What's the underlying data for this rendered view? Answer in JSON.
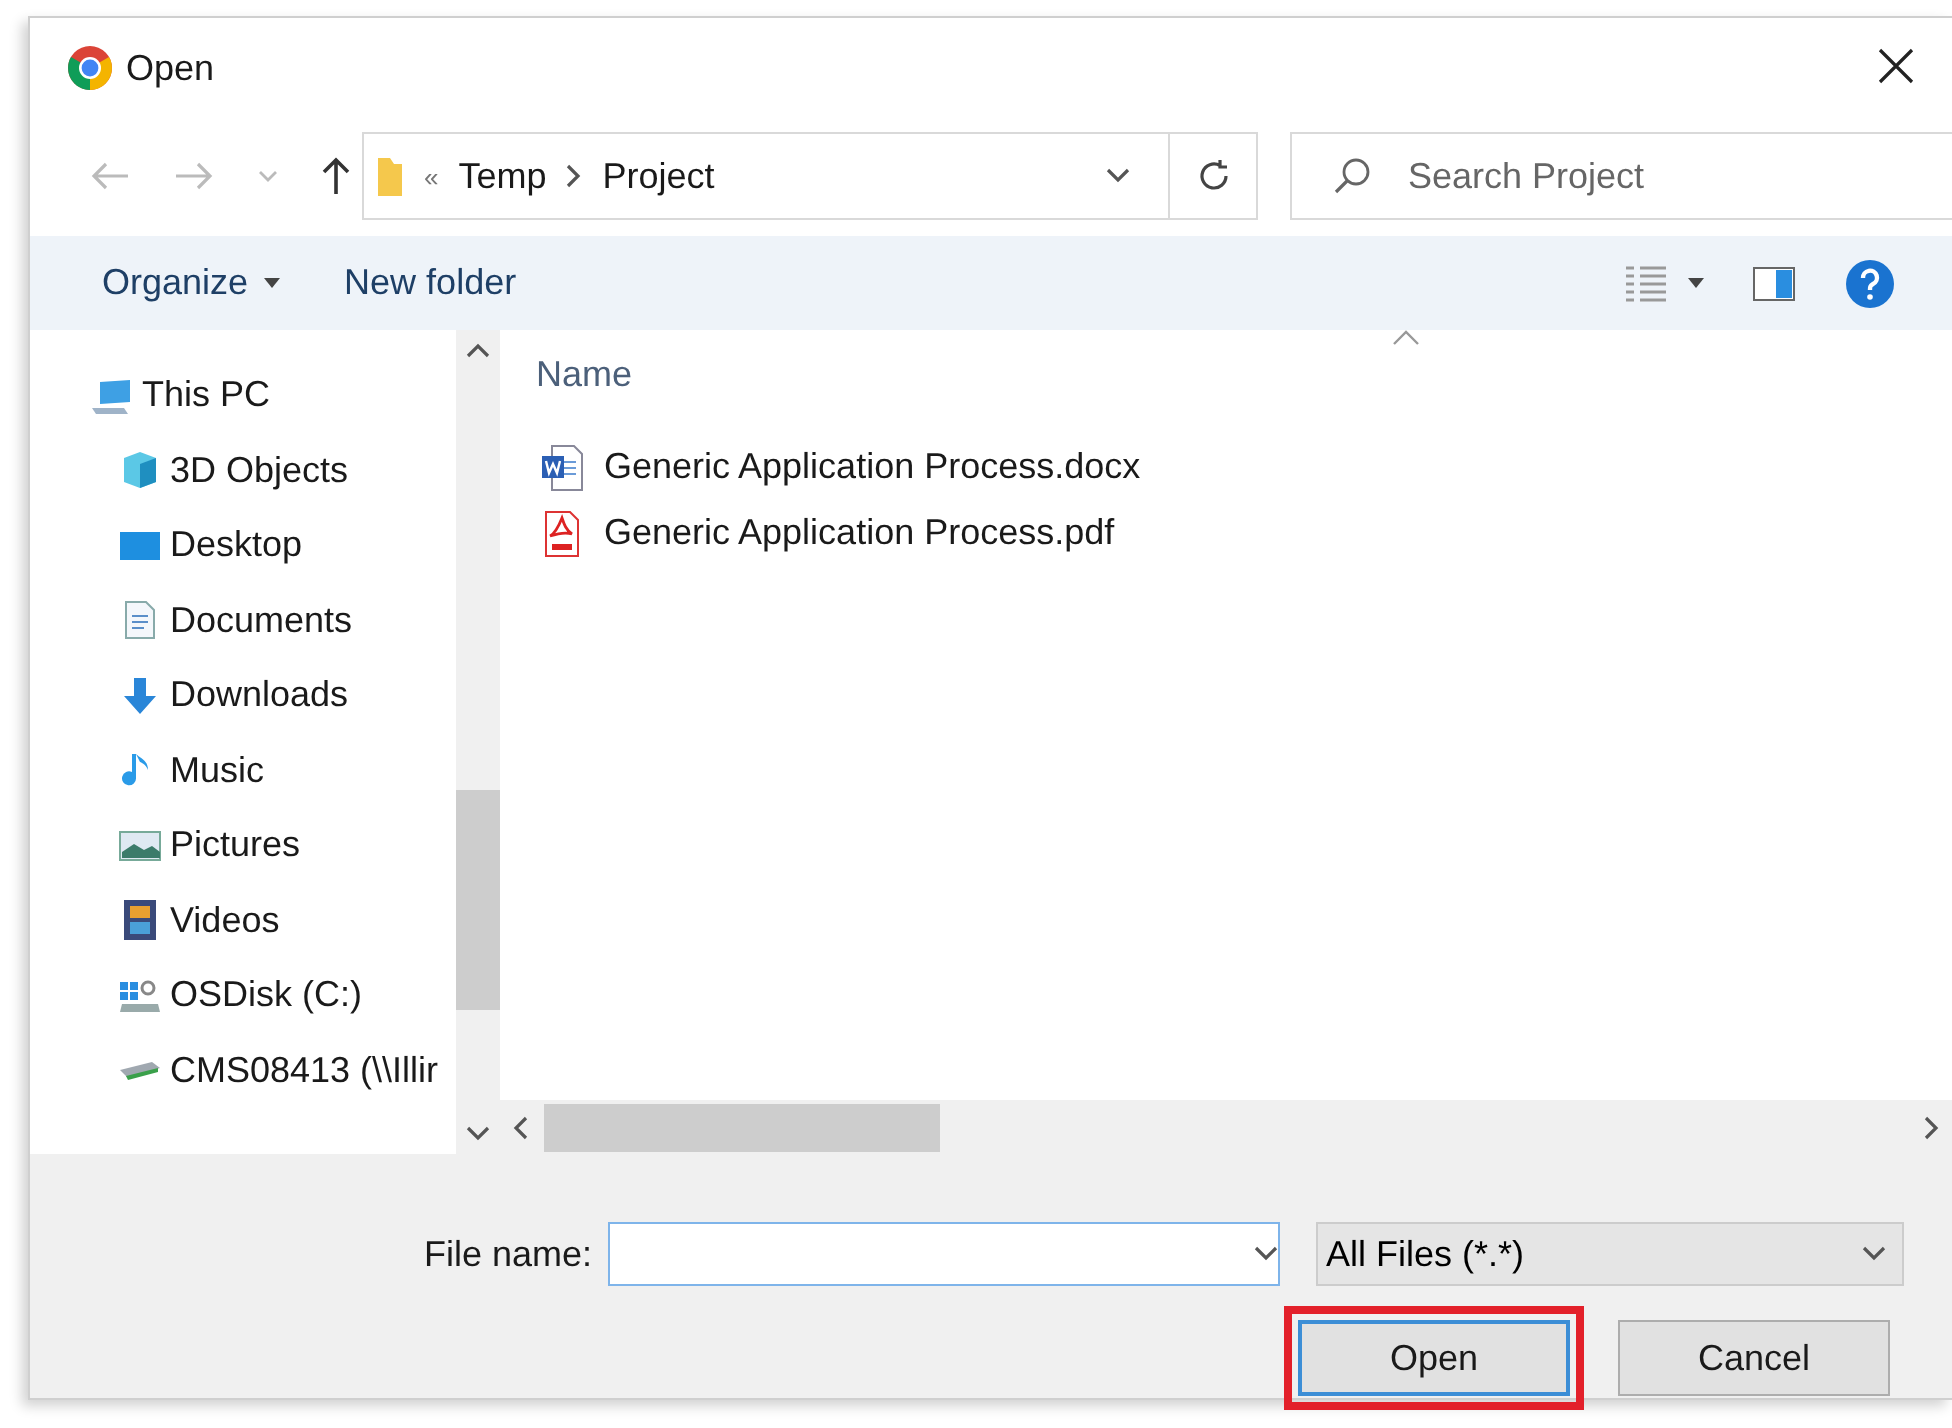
{
  "window": {
    "title": "Open"
  },
  "address": {
    "overflow": "«",
    "path": [
      "Temp",
      "Project"
    ]
  },
  "search": {
    "placeholder": "Search Project"
  },
  "toolbar": {
    "organize": "Organize",
    "new_folder": "New folder"
  },
  "navigation": [
    {
      "label": "This PC",
      "kind": "pc",
      "children": [
        {
          "label": "3D Objects",
          "kind": "cube"
        },
        {
          "label": "Desktop",
          "kind": "desktop"
        },
        {
          "label": "Documents",
          "kind": "documents"
        },
        {
          "label": "Downloads",
          "kind": "downloads"
        },
        {
          "label": "Music",
          "kind": "music"
        },
        {
          "label": "Pictures",
          "kind": "pictures"
        },
        {
          "label": "Videos",
          "kind": "videos"
        },
        {
          "label": "OSDisk (C:)",
          "kind": "disk"
        },
        {
          "label": "CMS08413 (\\\\Illir",
          "kind": "network"
        }
      ]
    }
  ],
  "file_list": {
    "columns": [
      "Name"
    ],
    "files": [
      {
        "name": "Generic Application Process.docx",
        "kind": "docx"
      },
      {
        "name": "Generic Application Process.pdf",
        "kind": "pdf"
      }
    ]
  },
  "file_name": {
    "label": "File name:"
  },
  "file_type": {
    "value": "All Files (*.*)"
  },
  "buttons": [
    {
      "label": "Open",
      "highlighted": true,
      "default": true
    },
    {
      "label": "Cancel",
      "highlighted": false,
      "default": false
    }
  ]
}
